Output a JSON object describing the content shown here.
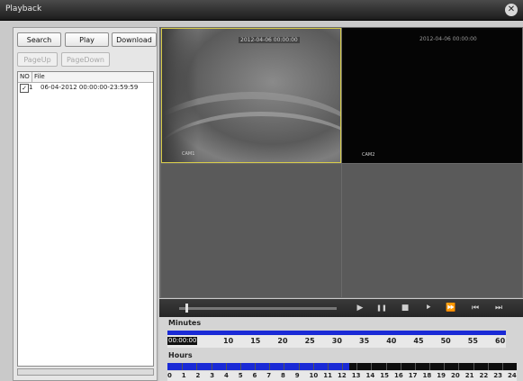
{
  "window": {
    "title": "Playback",
    "close_glyph": "✕"
  },
  "toolbar": {
    "search_label": "Search",
    "play_label": "Play",
    "download_label": "Download",
    "pageup_label": "PageUp",
    "pagedown_label": "PageDown"
  },
  "file_list": {
    "columns": [
      "NO",
      "File"
    ],
    "rows": [
      {
        "checked": true,
        "check_glyph": "✓",
        "no": "1",
        "file": "06-04-2012 00:00:00-23:59:59"
      }
    ]
  },
  "video": {
    "channel1_timestamp": "2012-04-06 00:00:00",
    "channel2_timestamp": "2012-04-06 00:00:00",
    "channel1_label": "CAM1",
    "channel2_label": "CAM2"
  },
  "controls": {
    "play": "▶",
    "pause": "❚❚",
    "stop": "■",
    "step": "⯈",
    "fast_forward": "⏩",
    "previous": "⏮",
    "next": "⏭",
    "progress": 0.04
  },
  "timeline": {
    "minutes_label": "Minutes",
    "hours_label": "Hours",
    "current_time": "00:00:00",
    "minute_ticks": [
      "10",
      "15",
      "20",
      "25",
      "30",
      "35",
      "40",
      "45",
      "50",
      "55",
      "60"
    ],
    "hour_ticks": [
      "0",
      "1",
      "2",
      "3",
      "4",
      "5",
      "6",
      "7",
      "8",
      "9",
      "10",
      "11",
      "12",
      "13",
      "14",
      "15",
      "16",
      "17",
      "18",
      "19",
      "20",
      "21",
      "22",
      "23",
      "24"
    ],
    "hours_recorded_fraction": 0.52,
    "colors": {
      "recorded": "#1a2ad6",
      "empty": "#0d0d0d"
    }
  }
}
